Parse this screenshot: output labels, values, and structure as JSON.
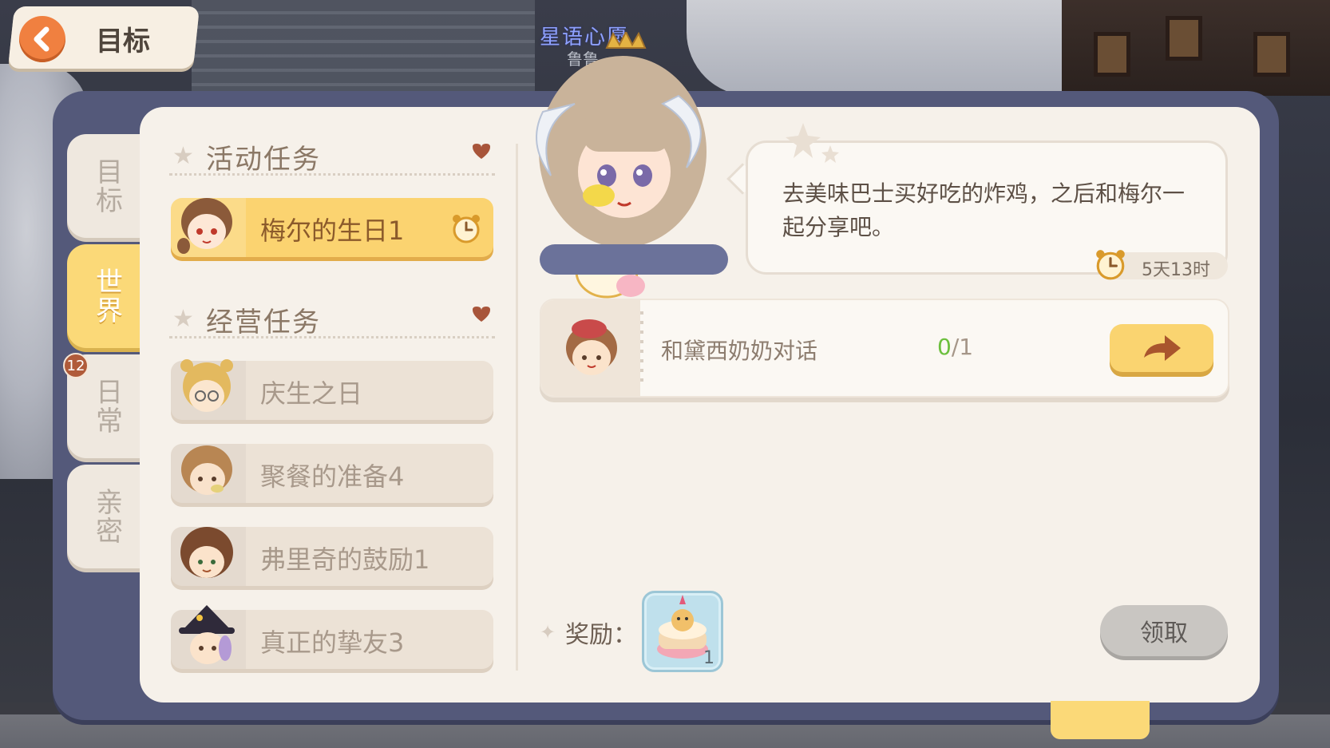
{
  "header": {
    "back_title": "目标",
    "npc_name": "星语心愿",
    "npc_sub": "鲁鲁"
  },
  "side_tabs": [
    {
      "label": "目标",
      "active": false
    },
    {
      "label": "世界",
      "active": true
    },
    {
      "label": "日常",
      "active": false,
      "badge": "12"
    },
    {
      "label": "亲密",
      "active": false
    }
  ],
  "sections": [
    {
      "title": "活动任务",
      "items": [
        {
          "label": "梅尔的生日1",
          "active": true,
          "has_clock": true
        }
      ]
    },
    {
      "title": "经营任务",
      "items": [
        {
          "label": "庆生之日",
          "active": false
        },
        {
          "label": "聚餐的准备4",
          "active": false
        },
        {
          "label": "弗里奇的鼓励1",
          "active": false
        },
        {
          "label": "真正的挚友3",
          "active": false
        }
      ]
    }
  ],
  "dialogue": {
    "text": "去美味巴士买好吃的炸鸡，之后和梅尔一起分享吧。",
    "time_left": "5天13时"
  },
  "objective": {
    "text": "和黛西奶奶对话",
    "progress_done": "0",
    "progress_total": "1"
  },
  "reward": {
    "label": "奖励：",
    "count": "1"
  },
  "claim_button": "领取",
  "colors": {
    "accent_yellow": "#fbd370",
    "panel_bg": "#f6f1ea",
    "window_frame": "#54597a",
    "progress_green": "#6cbf3d"
  }
}
